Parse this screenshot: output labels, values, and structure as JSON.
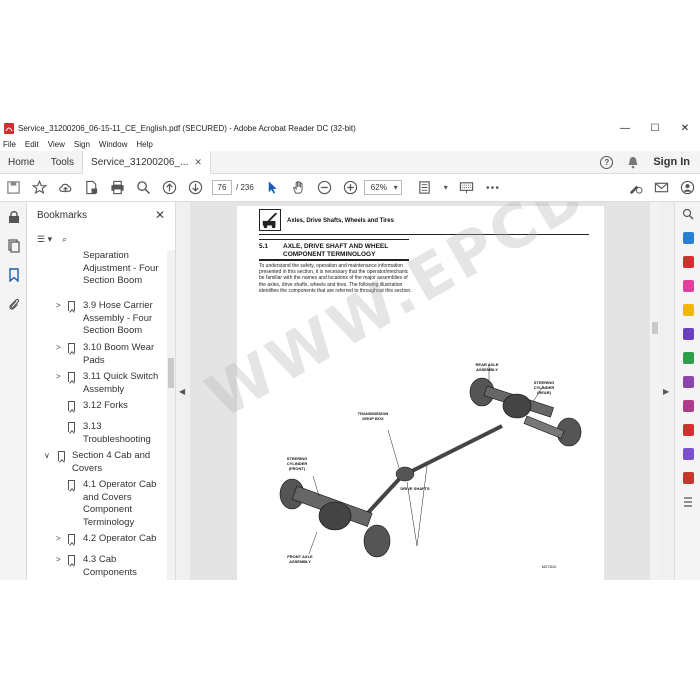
{
  "window": {
    "title": "Service_31200206_06-15-11_CE_English.pdf (SECURED) - Adobe Acrobat Reader DC (32-bit)",
    "minimize": "—",
    "maximize": "☐",
    "close": "✕"
  },
  "menu": [
    "File",
    "Edit",
    "View",
    "Sign",
    "Window",
    "Help"
  ],
  "tabs": {
    "home": "Home",
    "tools": "Tools",
    "document": "Service_31200206_...",
    "help": "?",
    "sign_in": "Sign In"
  },
  "toolbar": {
    "current_page": "76",
    "total_pages": "/ 236",
    "zoom": "62%"
  },
  "bookmarks": {
    "title": "Bookmarks",
    "items": [
      {
        "label": "Separation Adjustment - Four Section Boom",
        "level": 2,
        "expandable": false
      },
      {
        "label": "3.9 Hose Carrier Assembly - Four Section Boom",
        "level": 2,
        "expandable": true
      },
      {
        "label": "3.10 Boom Wear Pads",
        "level": 2,
        "expandable": true
      },
      {
        "label": "3.11 Quick Switch Assembly",
        "level": 2,
        "expandable": true
      },
      {
        "label": "3.12 Forks",
        "level": 2,
        "expandable": false
      },
      {
        "label": "3.13 Troubleshooting",
        "level": 2,
        "expandable": false
      },
      {
        "label": "Section 4 Cab and Covers",
        "level": 1,
        "expandable": true,
        "expanded": true
      },
      {
        "label": "4.1 Operator Cab and Covers Component Terminology",
        "level": 2,
        "expandable": false
      },
      {
        "label": "4.2 Operator Cab",
        "level": 2,
        "expandable": true
      },
      {
        "label": "4.3 Cab Components",
        "level": 2,
        "expandable": true
      }
    ]
  },
  "document": {
    "header": "Axles, Drive Shafts, Wheels and Tires",
    "section_number": "5.1",
    "section_title": "AXLE, DRIVE SHAFT AND WHEEL COMPONENT TERMINOLOGY",
    "paragraph": "To understand the safety, operation and maintenance information presented in this section, it is necessary that the operator/mechanic be familiar with the names and locations of the major assemblies of the axles, drive shafts, wheels and tires. The following illustration identifies the components that are referred to throughout this section.",
    "labels": {
      "rear_axle": "REAR AXLE ASSEMBLY",
      "steering_rear": "STEERING CYLINDER (REAR)",
      "transmission": "TRANSMISSION DROP BOX",
      "steering_front": "STEERING CYLINDER (FRONT)",
      "drive_shafts": "DRIVE SHAFTS",
      "front_axle": "FRONT AXLE ASSEMBLY",
      "figure_id": "MZ7810"
    },
    "watermark": "WWW.EPCDEPO.COM"
  },
  "colors": {
    "accent": "#1a5fb4",
    "pdf_red": "#d32f2f"
  }
}
